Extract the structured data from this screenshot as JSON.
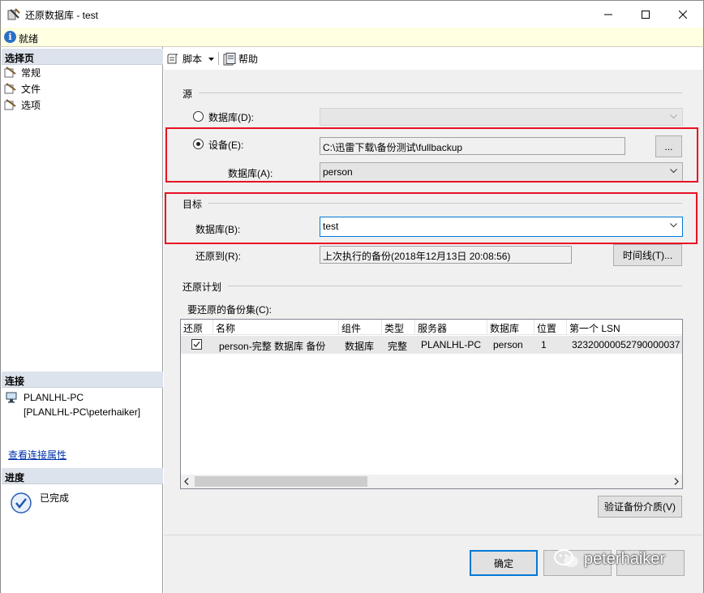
{
  "window": {
    "title": "还原数据库 - test",
    "controls": [
      "minimize-icon",
      "maximize-icon",
      "close-icon"
    ]
  },
  "status": {
    "text": "就绪"
  },
  "left_panel": {
    "select_page_title": "选择页",
    "pages": [
      {
        "label": "常规"
      },
      {
        "label": "文件"
      },
      {
        "label": "选项"
      }
    ],
    "connection_title": "连接",
    "connection_server": "PLANLHL-PC",
    "connection_user": "[PLANLHL-PC\\peterhaiker]",
    "view_connection_link": "查看连接属性",
    "progress_title": "进度",
    "progress_status": "已完成"
  },
  "toolbar": {
    "script_label": "脚本",
    "help_label": "帮助"
  },
  "source": {
    "group_label": "源",
    "database_radio": "数据库(D):",
    "device_radio": "设备(E):",
    "device_path": "C:\\迅雷下载\\备份测试\\fullbackup",
    "browse_label": "...",
    "database_label": "数据库(A):",
    "database_value": "person",
    "selected": "device"
  },
  "target": {
    "group_label": "目标",
    "database_label": "数据库(B):",
    "database_value": "test",
    "restore_to_label": "还原到(R):",
    "restore_to_value": "上次执行的备份(2018年12月13日 20:08:56)",
    "timeline_button": "时间线(T)..."
  },
  "plan": {
    "group_label": "还原计划",
    "backup_sets_label": "要还原的备份集(C):",
    "columns": [
      "还原",
      "名称",
      "组件",
      "类型",
      "服务器",
      "数据库",
      "位置",
      "第一个 LSN"
    ],
    "rows": [
      {
        "restore": true,
        "name": "person-完整 数据库 备份",
        "component": "数据库",
        "type": "完整",
        "server": "PLANLHL-PC",
        "database": "person",
        "position": "1",
        "first_lsn": "32320000052790000037"
      }
    ],
    "verify_button": "验证备份介质(V)"
  },
  "footer": {
    "ok_button": "确定",
    "watermark": "peterhaiker"
  },
  "colors": {
    "highlight_box": "#e81123",
    "status_bar": "#ffffe1",
    "accent": "#0078d7"
  }
}
